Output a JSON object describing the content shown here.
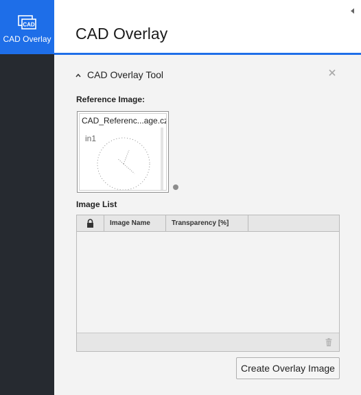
{
  "rail": {
    "item_label": "CAD Overlay",
    "icon_text": "CAD",
    "accent": "#1e6ee8",
    "background": "#262a30"
  },
  "header": {
    "title": "CAD Overlay"
  },
  "tool": {
    "section_title": "CAD Overlay Tool",
    "reference_label": "Reference Image:",
    "reference_file": "CAD_Referenc...age.czi",
    "reference_tag": "in1",
    "image_list_label": "Image List",
    "columns": [
      "Image Name",
      "Transparency [%]"
    ],
    "rows": [],
    "create_button": "Create Overlay Image"
  },
  "icons": {
    "rail": "cad-icon",
    "collapse": "chevron-left-icon",
    "section": "chevron-up-icon",
    "close": "close-icon",
    "lock": "lock-icon",
    "delete": "trash-icon"
  }
}
